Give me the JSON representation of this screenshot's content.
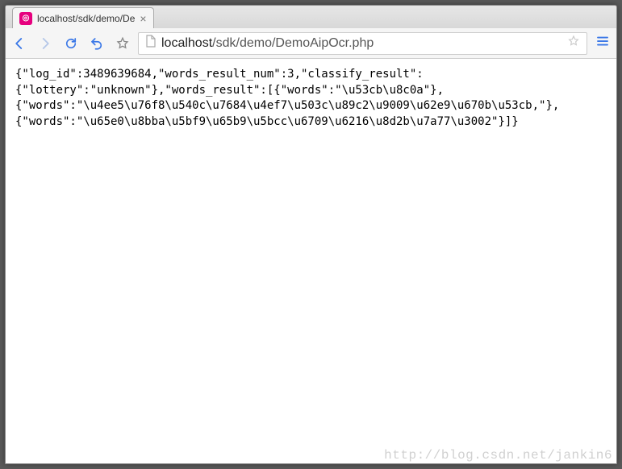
{
  "window": {
    "tab_title": "localhost/sdk/demo/De",
    "favicon_glyph": "◎"
  },
  "addressbar": {
    "url_host": "localhost",
    "url_path": "/sdk/demo/DemoAipOcr.php"
  },
  "page_body": {
    "line1": "{\"log_id\":3489639684,\"words_result_num\":3,\"classify_result\":",
    "line2": "{\"lottery\":\"unknown\"},\"words_result\":[{\"words\":\"\\u53cb\\u8c0a\"},",
    "line3": "{\"words\":\"\\u4ee5\\u76f8\\u540c\\u7684\\u4ef7\\u503c\\u89c2\\u9009\\u62e9\\u670b\\u53cb,\"},",
    "line4": "{\"words\":\"\\u65e0\\u8bba\\u5bf9\\u65b9\\u5bcc\\u6709\\u6216\\u8d2b\\u7a77\\u3002\"}]}"
  },
  "watermark": "http://blog.csdn.net/jankin6"
}
